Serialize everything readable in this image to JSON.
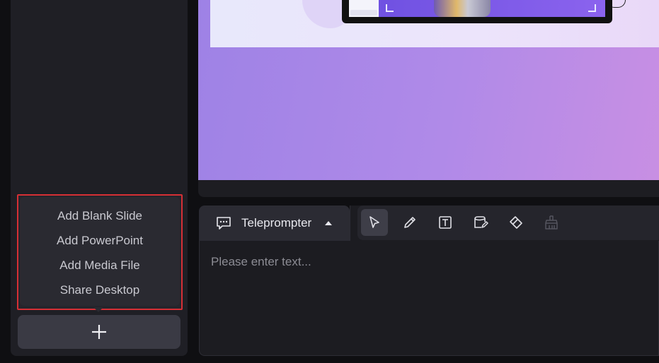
{
  "add_menu": {
    "items": [
      {
        "label": "Add Blank Slide"
      },
      {
        "label": "Add PowerPoint"
      },
      {
        "label": "Add Media File"
      },
      {
        "label": "Share Desktop"
      }
    ],
    "highlight_color": "#d62f35"
  },
  "add_button": {
    "icon": "plus-icon"
  },
  "teleprompter": {
    "tab_label": "Teleprompter",
    "icon": "chat-bubble-icon",
    "dropdown_icon": "caret-up-icon",
    "placeholder": "Please enter text...",
    "value": ""
  },
  "toolbar": {
    "tools": [
      {
        "name": "select",
        "icon": "cursor-arrow-icon",
        "active": true
      },
      {
        "name": "pen",
        "icon": "pencil-icon",
        "active": false
      },
      {
        "name": "text",
        "icon": "text-box-icon",
        "active": false
      },
      {
        "name": "note",
        "icon": "sticky-note-icon",
        "active": false
      },
      {
        "name": "eraser",
        "icon": "eraser-icon",
        "active": false
      },
      {
        "name": "clear",
        "icon": "broom-icon",
        "active": false,
        "disabled": true
      }
    ]
  },
  "colors": {
    "panel": "#1f1f25",
    "accent_purple": "#9e82e6",
    "background": "#0f0f12"
  }
}
